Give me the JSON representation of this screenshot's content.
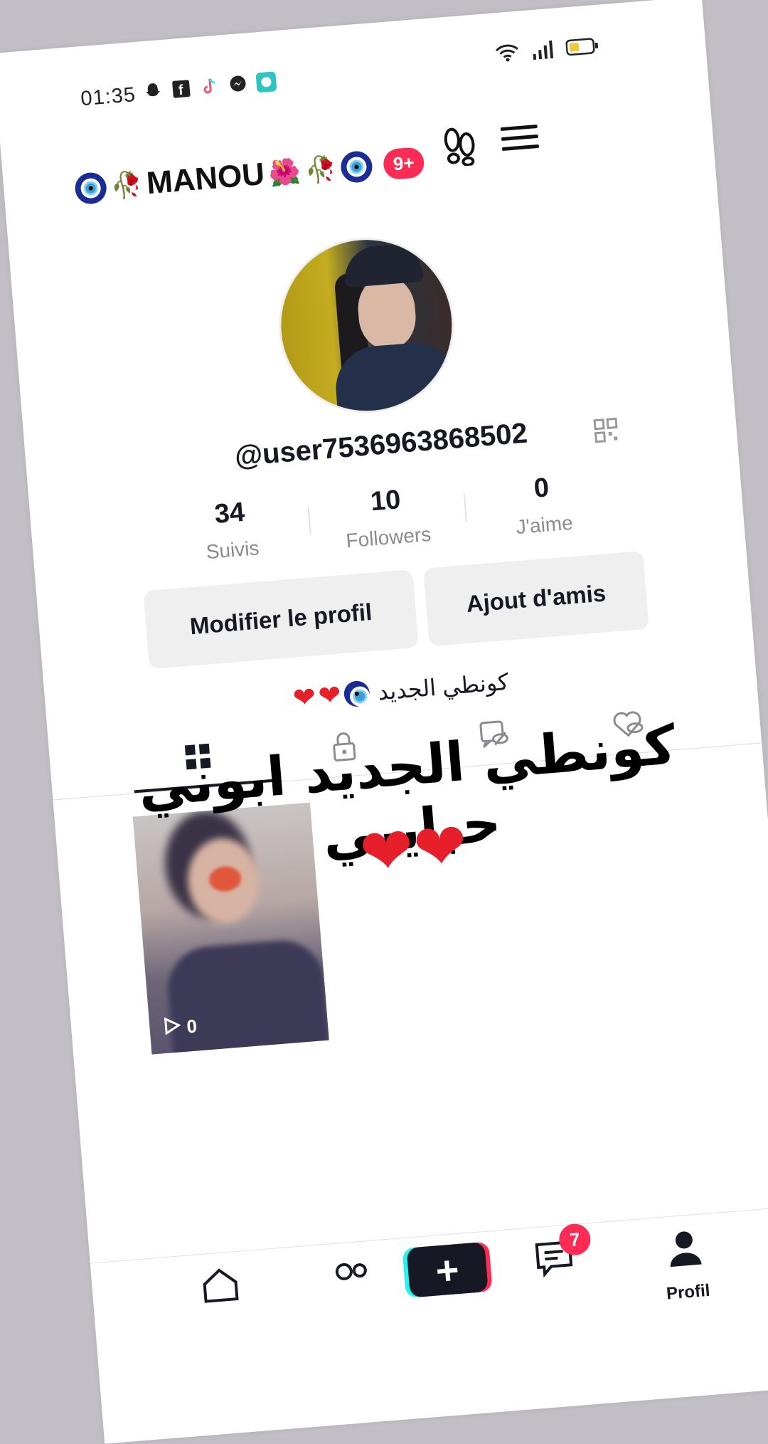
{
  "status_bar": {
    "time": "01:35"
  },
  "header": {
    "name": "MANOU",
    "badge": "9+"
  },
  "profile": {
    "username": "@user7536963868502",
    "stats": [
      {
        "value": "34",
        "label": "Suivis"
      },
      {
        "value": "10",
        "label": "Followers"
      },
      {
        "value": "0",
        "label": "J'aime"
      }
    ],
    "buttons": {
      "edit": "Modifier le profil",
      "add_friends": "Ajout d'amis"
    },
    "bio": "كونطي الجديد"
  },
  "overlay": {
    "text": "كونطي الجديد ابوني حبايبي"
  },
  "video": {
    "views": "0"
  },
  "bottom_nav": {
    "inbox_badge": "7",
    "profile_label": "Profil"
  },
  "colors": {
    "accent": "#fe2c55",
    "cyan": "#25f4ee",
    "text": "#161823"
  }
}
